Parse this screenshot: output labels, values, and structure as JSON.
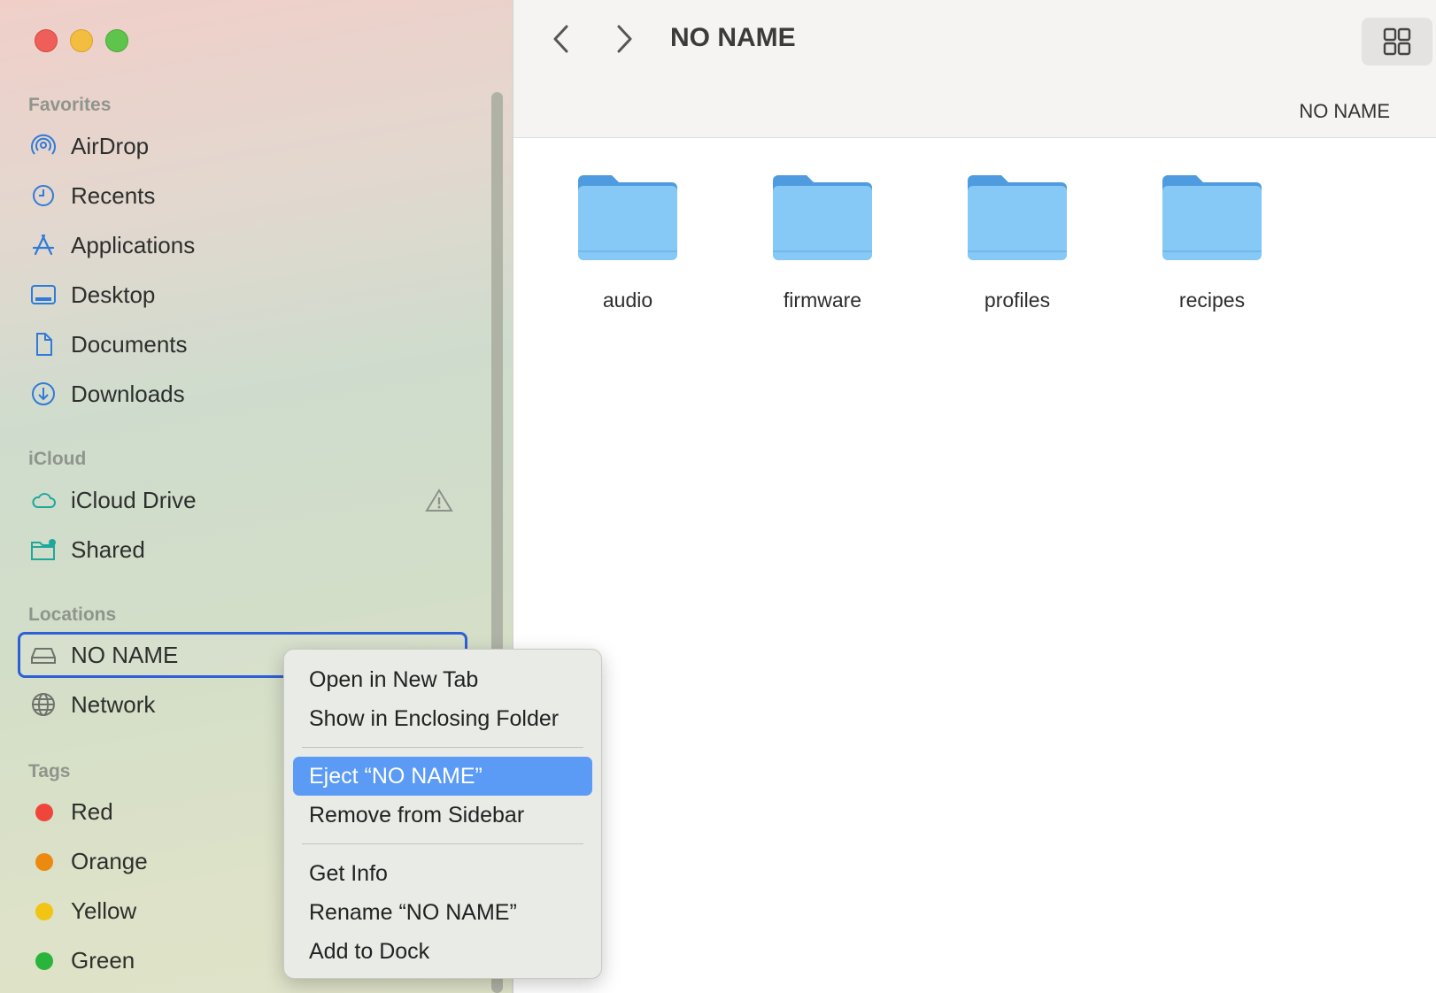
{
  "window": {
    "title": "NO NAME",
    "path_label": "NO NAME"
  },
  "sidebar": {
    "sections": {
      "favorites": "Favorites",
      "icloud": "iCloud",
      "locations": "Locations",
      "tags": "Tags"
    },
    "favorites": [
      {
        "label": "AirDrop",
        "icon": "airdrop-icon"
      },
      {
        "label": "Recents",
        "icon": "clock-icon"
      },
      {
        "label": "Applications",
        "icon": "applications-icon"
      },
      {
        "label": "Desktop",
        "icon": "desktop-icon"
      },
      {
        "label": "Documents",
        "icon": "document-icon"
      },
      {
        "label": "Downloads",
        "icon": "download-icon"
      }
    ],
    "icloud": [
      {
        "label": "iCloud Drive",
        "icon": "cloud-icon",
        "status_icon": "warning-icon"
      },
      {
        "label": "Shared",
        "icon": "shared-folder-icon"
      }
    ],
    "locations": [
      {
        "label": "NO NAME",
        "icon": "drive-icon",
        "selected": true
      },
      {
        "label": "Network",
        "icon": "globe-icon"
      }
    ],
    "tags": [
      {
        "label": "Red",
        "color": "#f0453a"
      },
      {
        "label": "Orange",
        "color": "#ec8a10"
      },
      {
        "label": "Yellow",
        "color": "#f2c413"
      },
      {
        "label": "Green",
        "color": "#29b53c"
      }
    ]
  },
  "content": {
    "folders": [
      {
        "name": "audio"
      },
      {
        "name": "firmware"
      },
      {
        "name": "profiles"
      },
      {
        "name": "recipes"
      }
    ]
  },
  "context_menu": {
    "groups": [
      [
        "Open in New Tab",
        "Show in Enclosing Folder"
      ],
      [
        "Eject “NO NAME”",
        "Remove from Sidebar"
      ],
      [
        "Get Info",
        "Rename “NO NAME”",
        "Add to Dock"
      ]
    ],
    "highlighted": "Eject “NO NAME”"
  },
  "colors": {
    "accent": "#2f5fd6",
    "menu_highlight": "#5b9bf5",
    "folder": "#7cc4f5"
  }
}
